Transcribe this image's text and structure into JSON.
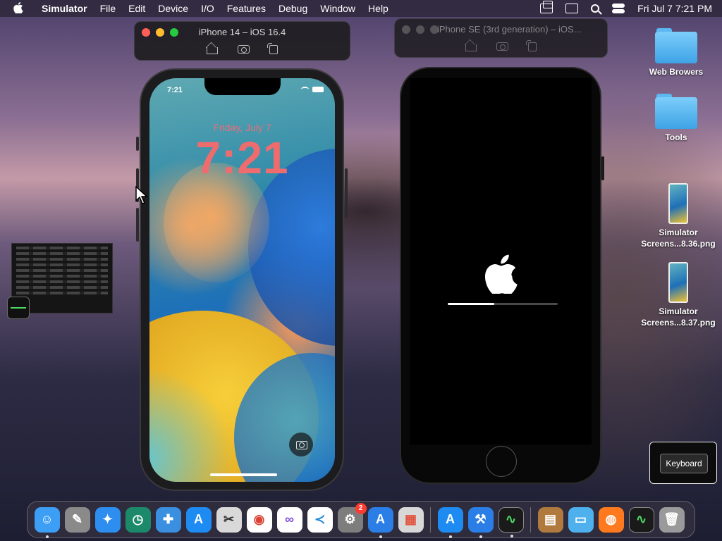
{
  "menubar": {
    "apple_icon": "apple-logo-icon",
    "app_name": "Simulator",
    "items": [
      "File",
      "Edit",
      "Device",
      "I/O",
      "Features",
      "Debug",
      "Window",
      "Help"
    ],
    "datetime": "Fri Jul 7  7:21 PM"
  },
  "windows": {
    "iphone14": {
      "title": "iPhone 14 – iOS 16.4"
    },
    "iphonese": {
      "title": "iPhone SE (3rd generation) – iOS..."
    }
  },
  "iphone14_screen": {
    "status_time": "7:21",
    "lock_date": "Friday, July 7",
    "lock_time": "7:21"
  },
  "iphonese_screen": {
    "boot_progress": 0.42
  },
  "desktop": {
    "items": [
      {
        "label": "Web Browers",
        "type": "folder"
      },
      {
        "label": "Tools",
        "type": "folder"
      },
      {
        "label": "Simulator Screens...8.36.png",
        "type": "screenshot"
      },
      {
        "label": "Simulator Screens...8.37.png",
        "type": "screenshot"
      }
    ]
  },
  "keyboard_panel": {
    "button_label": "Keyboard"
  },
  "dock": {
    "badge_count": "2",
    "apps": [
      {
        "name": "finder-icon",
        "color": "#3c9ef5"
      },
      {
        "name": "script-editor-icon",
        "color": "#8a8a8a"
      },
      {
        "name": "safari-icon",
        "color": "#2e8ef0"
      },
      {
        "name": "time-machine-icon",
        "color": "#1c8a6a"
      },
      {
        "name": "networking-icon",
        "color": "#3a8fe0"
      },
      {
        "name": "app-store-icon",
        "color": "#1d8bf1"
      },
      {
        "name": "preview-icon",
        "color": "#d9d9d9"
      },
      {
        "name": "chrome-icon",
        "color": "#ffffff"
      },
      {
        "name": "visual-studio-icon",
        "color": "#ffffff"
      },
      {
        "name": "vscode-icon",
        "color": "#ffffff"
      },
      {
        "name": "system-settings-icon",
        "color": "#7d7d7d"
      },
      {
        "name": "xcode-instruments-icon",
        "color": "#2a7ee6"
      },
      {
        "name": "launchpad-icon",
        "color": "#d8d8d8"
      },
      {
        "name": "app-store-2-icon",
        "color": "#1d8bf1"
      },
      {
        "name": "xcode-icon",
        "color": "#2a7ee6"
      },
      {
        "name": "activity-monitor-icon",
        "color": "#1a1a1a"
      },
      {
        "name": "archive-icon",
        "color": "#b07a3e"
      },
      {
        "name": "folder-icon",
        "color": "#4fb0ee"
      },
      {
        "name": "firefox-icon",
        "color": "#ff7a1e"
      },
      {
        "name": "activity-monitor-2-icon",
        "color": "#1a1a1a"
      },
      {
        "name": "trash-icon",
        "color": "#9a9a9a"
      }
    ]
  }
}
